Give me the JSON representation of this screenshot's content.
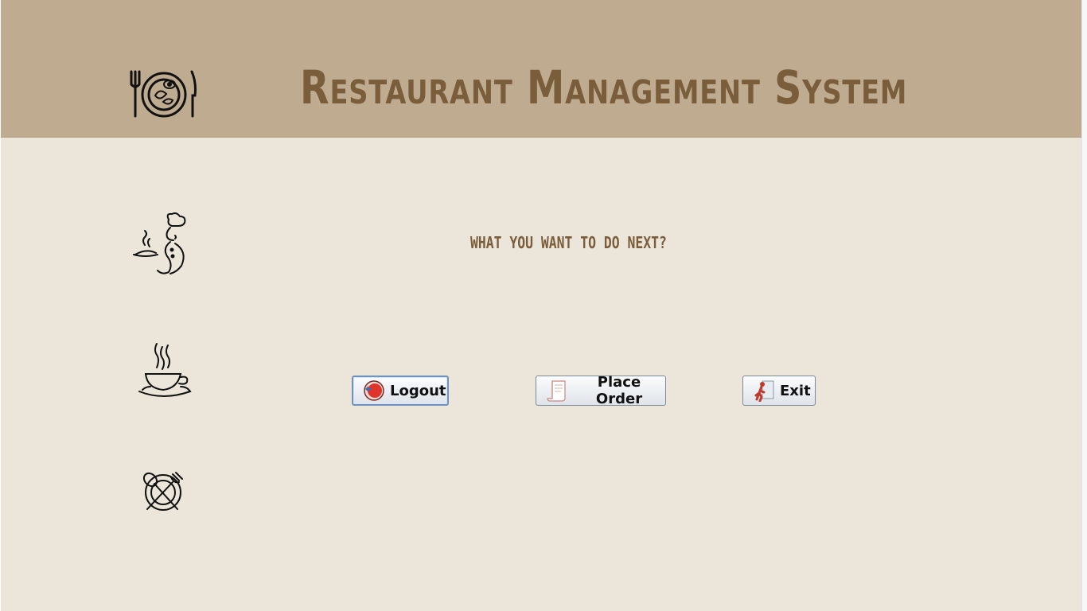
{
  "header": {
    "title": "Restaurant Management System",
    "logo_icon": "plate-cutlery-icon",
    "background_color": "#bfab90",
    "title_color": "#7a5e3b"
  },
  "sidebar_icons": [
    "chef-icon",
    "coffee-cup-icon",
    "plate-fork-spoon-icon"
  ],
  "main": {
    "prompt": "WHAT YOU WANT TO DO NEXT?",
    "background_color": "#ece5d9"
  },
  "actions": {
    "logout_label": "Logout",
    "logout_icon": "logout-icon",
    "place_order_label": "Place Order",
    "place_order_icon": "order-receipt-icon",
    "exit_label": "Exit",
    "exit_icon": "exit-running-man-icon"
  }
}
